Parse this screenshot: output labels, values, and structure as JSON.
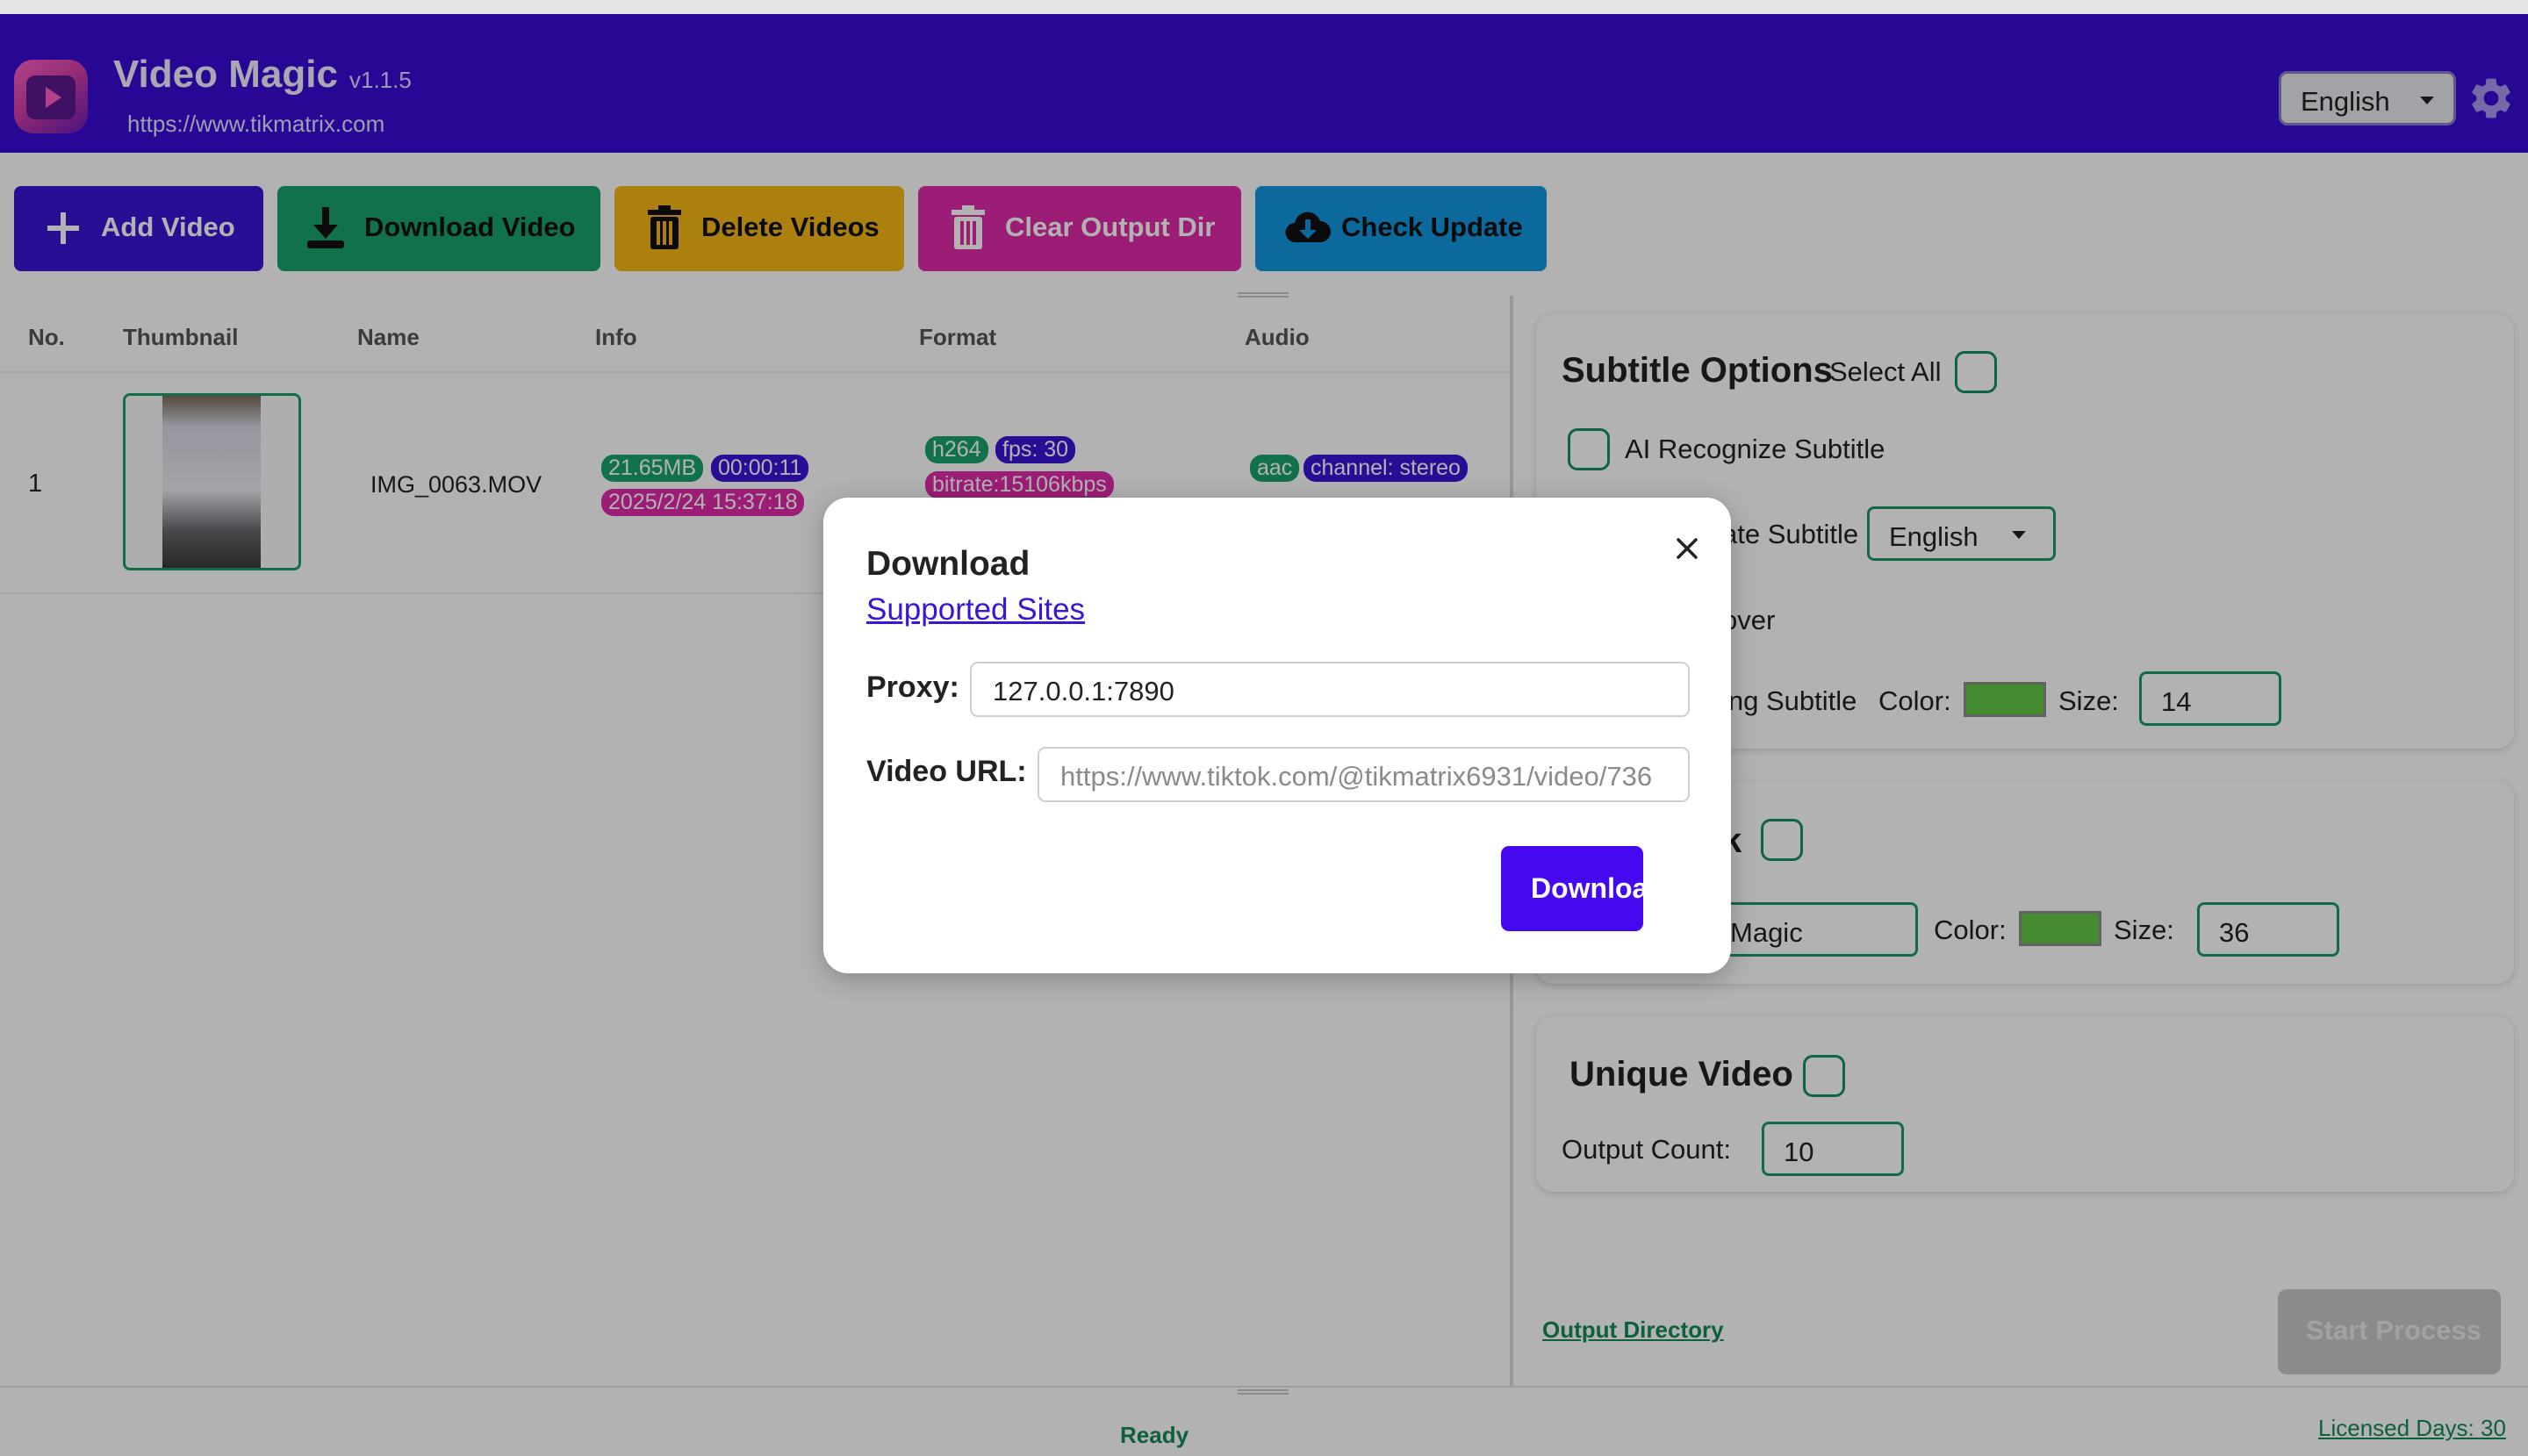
{
  "app": {
    "title": "Video Magic",
    "version": "v1.1.5",
    "url": "https://www.tikmatrix.com",
    "language": "English"
  },
  "toolbar": {
    "add_video": "Add Video",
    "download_video": "Download Video",
    "delete_videos": "Delete Videos",
    "clear_output_dir": "Clear Output Dir",
    "check_update": "Check Update"
  },
  "table": {
    "headers": [
      "No.",
      "Thumbnail",
      "Name",
      "Info",
      "Format",
      "Audio"
    ],
    "rows": [
      {
        "no": "1",
        "name": "IMG_0063.MOV",
        "info": {
          "size": "21.65MB",
          "duration": "00:00:11",
          "date": "2025/2/24 15:37:18"
        },
        "format": {
          "codec": "h264",
          "fps": "fps: 30",
          "bitrate": "bitrate:15106kbps"
        },
        "audio": {
          "codec": "aac",
          "channel": "channel: stereo"
        }
      }
    ]
  },
  "subtitle_options": {
    "title": "Subtitle Options",
    "select_all": "Select All",
    "ai_recognize": "AI Recognize Subtitle",
    "translate_label": "ate Subtitle",
    "translate_language": "English",
    "cover_label": "over",
    "burning_label": "ing Subtitle",
    "color_label": "Color:",
    "size_label": "Size:",
    "size_value": "14",
    "color": "#63c746"
  },
  "watermark": {
    "title_fragment": "k",
    "text_value": "Magic",
    "color_label": "Color:",
    "size_label": "Size:",
    "size_value": "36",
    "color": "#63c746"
  },
  "unique_video": {
    "title": "Unique Video",
    "output_count_label": "Output Count:",
    "output_count_value": "10"
  },
  "footer": {
    "output_directory": "Output Directory",
    "start_process": "Start Process",
    "status": "Ready",
    "licensed_days": "Licensed Days: 30"
  },
  "modal": {
    "title": "Download",
    "supported_sites": "Supported Sites",
    "proxy_label": "Proxy:",
    "proxy_value": "127.0.0.1:7890",
    "video_url_label": "Video URL:",
    "video_url_placeholder": "https://www.tiktok.com/@tikmatrix6931/video/736",
    "download_button": "Download"
  },
  "colors": {
    "header": "#3b0bd6",
    "add_video": "#3b14d4",
    "download_video": "#17a36a",
    "delete_videos": "#f5b815",
    "clear_output_dir": "#e02aa8",
    "check_update": "#1297e0",
    "accent_green": "#159060"
  }
}
